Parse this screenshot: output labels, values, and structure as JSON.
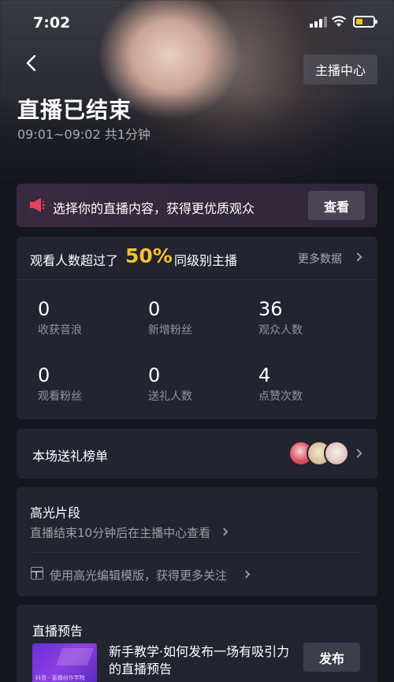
{
  "status_bar": {
    "time": "7:02"
  },
  "header": {
    "host_center_label": "主播中心",
    "title": "直播已结束",
    "subtitle": "09:01~09:02 共1分钟"
  },
  "banner": {
    "text": "选择你的直播内容，获得更优质观众",
    "button_label": "查看"
  },
  "stats": {
    "lead_text": "观看人数超过了",
    "percent": "50%",
    "tail_text": "同级别主播",
    "more_label": "更多数据",
    "items": [
      {
        "value": "0",
        "label": "收获音浪"
      },
      {
        "value": "0",
        "label": "新增粉丝"
      },
      {
        "value": "36",
        "label": "观众人数"
      },
      {
        "value": "0",
        "label": "观看粉丝"
      },
      {
        "value": "0",
        "label": "送礼人数"
      },
      {
        "value": "4",
        "label": "点赞次数"
      }
    ]
  },
  "gift_ranking": {
    "title": "本场送礼榜单"
  },
  "highlights": {
    "title": "高光片段",
    "hint": "直播结束10分钟后在主播中心查看",
    "template_text": "使用高光编辑模版，获得更多关注"
  },
  "live_preview": {
    "title": "直播预告",
    "thumbnail_caption": "抖音 · 直播创作学院",
    "item_text": "新手教学·如何发布一场有吸引力的直播预告",
    "publish_label": "发布"
  },
  "colors": {
    "accent_percent": "#f2c232",
    "battery": "#f5c518",
    "banner_icon": "#e8415a"
  },
  "icons": [
    "back-arrow-icon",
    "signal-icon",
    "wifi-icon",
    "battery-icon",
    "megaphone-icon",
    "chevron-right-icon",
    "template-icon"
  ]
}
